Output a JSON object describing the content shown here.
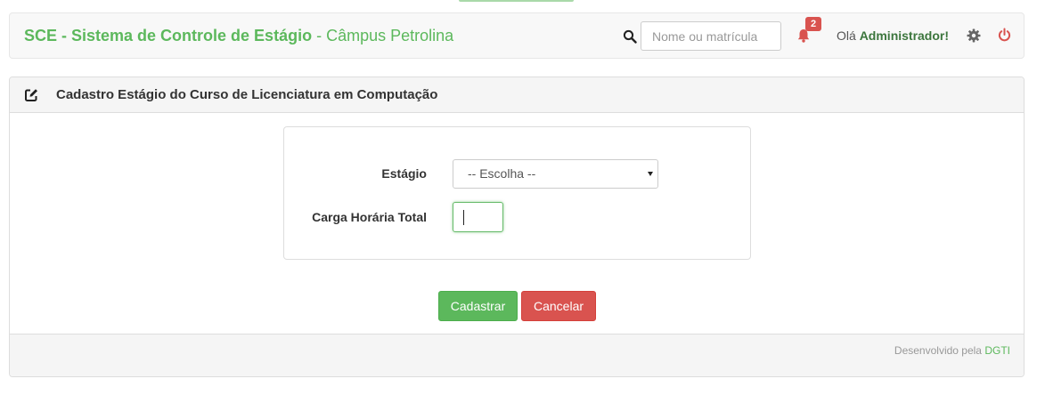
{
  "header": {
    "brand_strong": "SCE - Sistema de Controle de Estágio",
    "brand_separator": " - ",
    "brand_campus": "Câmpus Petrolina",
    "search_placeholder": "Nome ou matrícula",
    "notification_count": "2",
    "greeting_prefix": "Olá ",
    "user_name": "Administrador!"
  },
  "icons": {
    "search": "search-icon",
    "notifications": "bell-icon",
    "settings": "gear-icon",
    "logout": "power-icon",
    "edit": "edit-icon"
  },
  "panel": {
    "title": "Cadastro Estágio do Curso de Licenciatura em Computação"
  },
  "form": {
    "estagio_label": "Estágio",
    "estagio_selected": "-- Escolha --",
    "carga_label": "Carga Horária Total",
    "carga_value": ""
  },
  "actions": {
    "submit_label": "Cadastrar",
    "cancel_label": "Cancelar"
  },
  "footer": {
    "developed_by": "Desenvolvido pela ",
    "org_link": "DGTI"
  },
  "colors": {
    "brand_green": "#5cb85c",
    "danger_red": "#d9534f",
    "user_green": "#3c763d"
  }
}
